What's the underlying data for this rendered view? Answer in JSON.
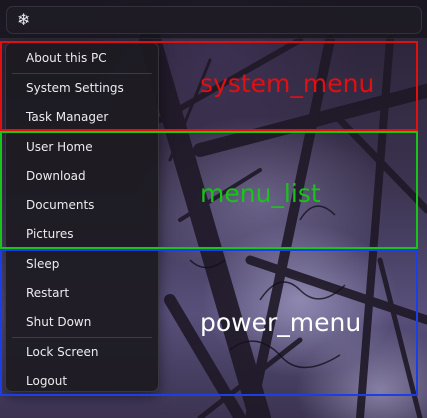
{
  "topbar": {
    "icon": "snowflake-icon",
    "icon_glyph": "❄"
  },
  "menu": {
    "system_items": [
      "About this PC",
      "System Settings",
      "Task Manager"
    ],
    "list_items": [
      "User Home",
      "Download",
      "Documents",
      "Pictures"
    ],
    "power_items": [
      "Sleep",
      "Restart",
      "Shut Down"
    ],
    "session_items": [
      "Lock Screen",
      "Logout"
    ]
  },
  "annotations": {
    "system_menu": {
      "label": "system_menu",
      "color": "#e01010"
    },
    "menu_list": {
      "label": "menu_list",
      "color": "#18c418"
    },
    "power_menu": {
      "label": "power_menu",
      "color": "#1a3ee8"
    }
  },
  "colors": {
    "menu_bg": "#1c1a20",
    "menu_text": "#ececf0"
  }
}
